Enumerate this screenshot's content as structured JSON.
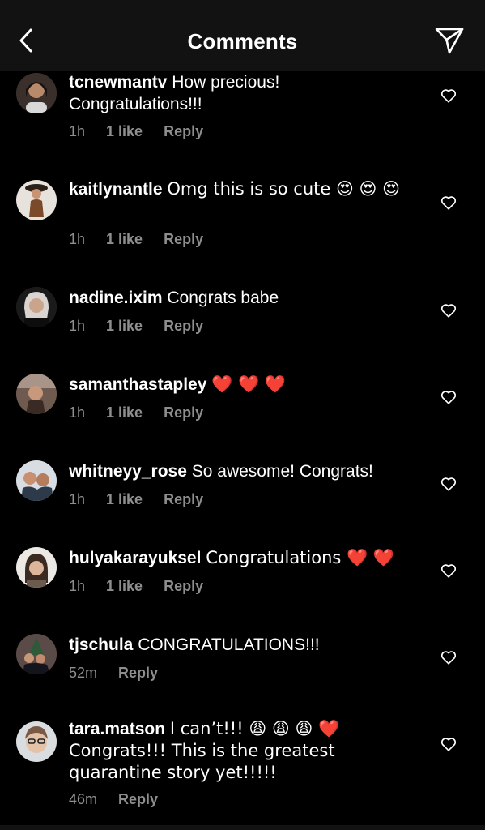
{
  "header": {
    "title": "Comments",
    "back_icon": "chevron-left-icon",
    "share_icon": "paper-plane-icon"
  },
  "comments": [
    {
      "username": "tcnewmantv",
      "text": "How precious! Congratulations!!!",
      "time": "1h",
      "likes": "1 like",
      "reply": "Reply"
    },
    {
      "username": "kaitlynantle",
      "text": "Omg this is so cute 😍 😍 😍",
      "time": "1h",
      "likes": "1 like",
      "reply": "Reply"
    },
    {
      "username": "nadine.ixim",
      "text": "Congrats babe",
      "time": "1h",
      "likes": "1 like",
      "reply": "Reply"
    },
    {
      "username": "samanthastapley",
      "text": "❤️ ❤️ ❤️",
      "time": "1h",
      "likes": "1 like",
      "reply": "Reply"
    },
    {
      "username": "whitneyy_rose",
      "text": "So awesome! Congrats!",
      "time": "1h",
      "likes": "1 like",
      "reply": "Reply"
    },
    {
      "username": "hulyakarayuksel",
      "text": "Congratulations ❤️ ❤️",
      "time": "1h",
      "likes": "1 like",
      "reply": "Reply"
    },
    {
      "username": "tjschula",
      "text": "CONGRATULATIONS!!!",
      "time": "52m",
      "likes": "",
      "reply": "Reply"
    },
    {
      "username": "tara.matson",
      "text": "I can’t!!! 😩 😩 😩 ❤️ Congrats!!! This is the greatest quarantine story yet!!!!!",
      "time": "46m",
      "likes": "",
      "reply": "Reply"
    }
  ],
  "colors": {
    "background": "#000000",
    "header_background": "#121212",
    "primary_text": "#ffffff",
    "secondary_text": "#8e8e8e"
  }
}
